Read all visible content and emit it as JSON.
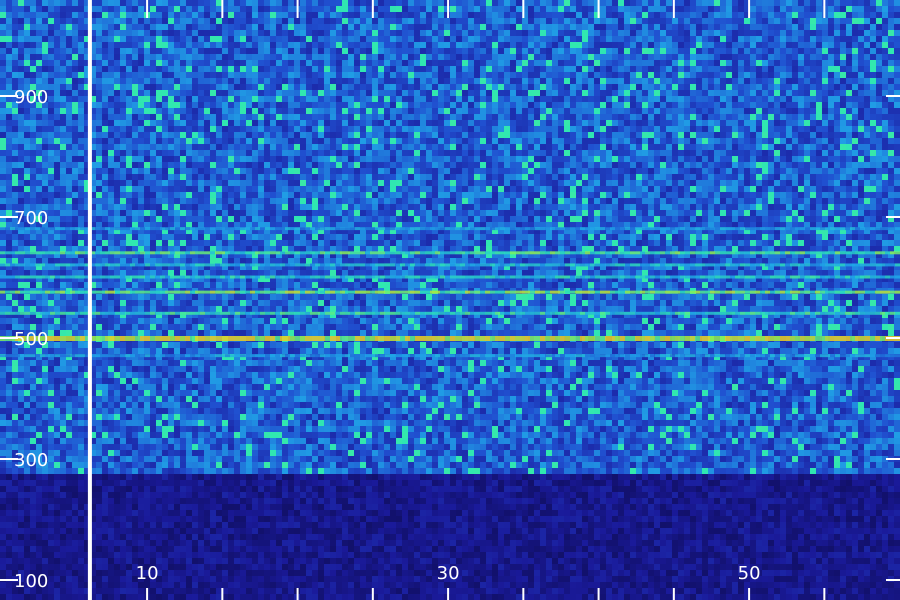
{
  "chart_data": {
    "type": "heatmap",
    "title": "",
    "xlabel": "",
    "ylabel": "",
    "x_ticks": [
      10,
      30,
      50
    ],
    "y_ticks": [
      100,
      300,
      500,
      700,
      900
    ],
    "xlim": [
      8.2,
      58
    ],
    "ylim": [
      100,
      1080
    ],
    "cursor_x": 6.2,
    "low_freq_cutoff": 280,
    "color_scale": [
      "#0a0840",
      "#1a1a9a",
      "#2050d0",
      "#20a8e8",
      "#30e8b0",
      "#a0f040",
      "#f0d020"
    ],
    "bands": [
      {
        "freq": 500,
        "intensity": 0.95
      },
      {
        "freq": 640,
        "intensity": 0.62
      },
      {
        "freq": 575,
        "intensity": 0.72
      },
      {
        "freq": 540,
        "intensity": 0.55
      },
      {
        "freq": 600,
        "intensity": 0.5
      },
      {
        "freq": 620,
        "intensity": 0.45
      },
      {
        "freq": 680,
        "intensity": 0.35
      },
      {
        "freq": 470,
        "intensity": 0.35
      }
    ]
  }
}
